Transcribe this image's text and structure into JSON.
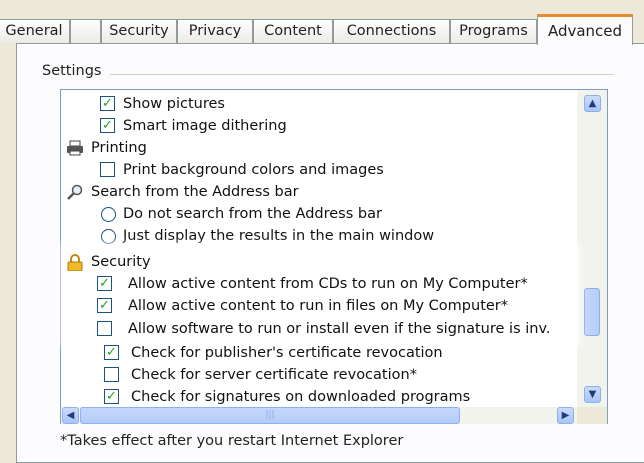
{
  "tabs": [
    {
      "label": "General"
    },
    {
      "label": "Security"
    },
    {
      "label": "Privacy"
    },
    {
      "label": "Content"
    },
    {
      "label": "Connections"
    },
    {
      "label": "Programs"
    },
    {
      "label": "Advanced",
      "active": true
    }
  ],
  "settings": {
    "group_label": "Settings",
    "items": [
      {
        "type": "checkbox",
        "label": "Show pictures",
        "checked": true
      },
      {
        "type": "checkbox",
        "label": "Smart image dithering",
        "checked": true
      },
      {
        "type": "category",
        "label": "Printing",
        "icon": "printer-icon"
      },
      {
        "type": "checkbox",
        "label": "Print background colors and images",
        "checked": false
      },
      {
        "type": "category",
        "label": "Search from the Address bar",
        "icon": "magnifier-icon"
      },
      {
        "type": "radio",
        "label": "Do not search from the Address bar",
        "checked": false
      },
      {
        "type": "radio",
        "label": "Just display the results in the main window",
        "checked": false
      },
      {
        "type": "category",
        "label": "Security",
        "icon": "padlock-icon"
      },
      {
        "type": "checkbox",
        "label": "Allow active content from CDs to run on My Computer*",
        "checked": true
      },
      {
        "type": "checkbox",
        "label": "Allow active content to run in files on My Computer*",
        "checked": true
      },
      {
        "type": "checkbox",
        "label": "Allow software to run or install even if the signature is inv.",
        "checked": false
      },
      {
        "type": "checkbox",
        "label": "Check for publisher's certificate revocation",
        "checked": true
      },
      {
        "type": "checkbox",
        "label": "Check for server certificate revocation*",
        "checked": false
      },
      {
        "type": "checkbox",
        "label": "Check for signatures on downloaded programs",
        "checked": true
      }
    ]
  },
  "footnote": "*Takes effect after you restart Internet Explorer",
  "icons": {
    "check": "✓",
    "scroll_up": "▲",
    "scroll_down": "▼",
    "scroll_left": "◀",
    "scroll_right": "▶"
  },
  "colors": {
    "active_tab_accent": "#e68b2c",
    "check_green": "#21a121",
    "scrollbar_blue": "#b6cdf8"
  }
}
